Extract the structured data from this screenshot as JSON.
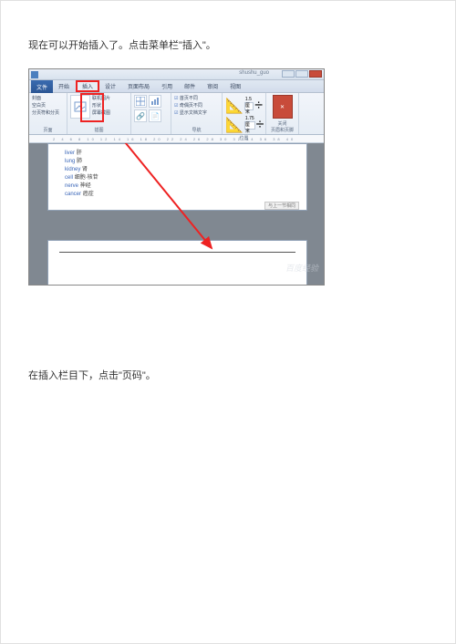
{
  "step1_text": "现在可以开始插入了。点击菜单栏\"插入\"。",
  "step2_text": "在插入栏目下，点击\"页码\"。",
  "app": {
    "title_right": "shushu_guo",
    "tabs": {
      "file": "文件",
      "start": "开始",
      "insert": "插入",
      "design": "设计",
      "pagelayout": "页面布局",
      "reference": "引用",
      "mail": "邮件",
      "review": "审阅",
      "view": "视图"
    },
    "ribbon": {
      "group_pages": {
        "cover": "封面",
        "blank": "空白页",
        "break": "分页符和分页",
        "label": "页面"
      },
      "group_illus": {
        "online_pic": "联机图片",
        "shapes": "形状",
        "screenshot": "屏幕截图",
        "label": "插图"
      },
      "group_nav": {
        "nav1": "首页不同",
        "nav2": "奇偶页不同",
        "nav3": "显示文档文字",
        "label": "导航"
      },
      "group_pos": {
        "label": "位置"
      },
      "group_spin": {
        "v1": "1.5 厘米",
        "v2": "1.75 厘米"
      },
      "group_close": {
        "close": "关闭",
        "sub": "页眉和页脚"
      }
    },
    "ruler": "2  4  6  8  10  12  14  16  18  20  22  24  26  28  30  32  34  36  38  40",
    "doc": {
      "l1_term": "liver",
      "l1_def": "肝",
      "l2_term": "lung",
      "l2_def": "肺",
      "l3_term": "kidney",
      "l3_def": "肾",
      "l4_term": "cell",
      "l4_def": "细胞·核苷",
      "l5_term": "nerve",
      "l5_def": "神经",
      "l6_term": "cancer",
      "l6_def": "癌症",
      "footer_note": "与上一节相同"
    },
    "watermark": "百度经验"
  }
}
